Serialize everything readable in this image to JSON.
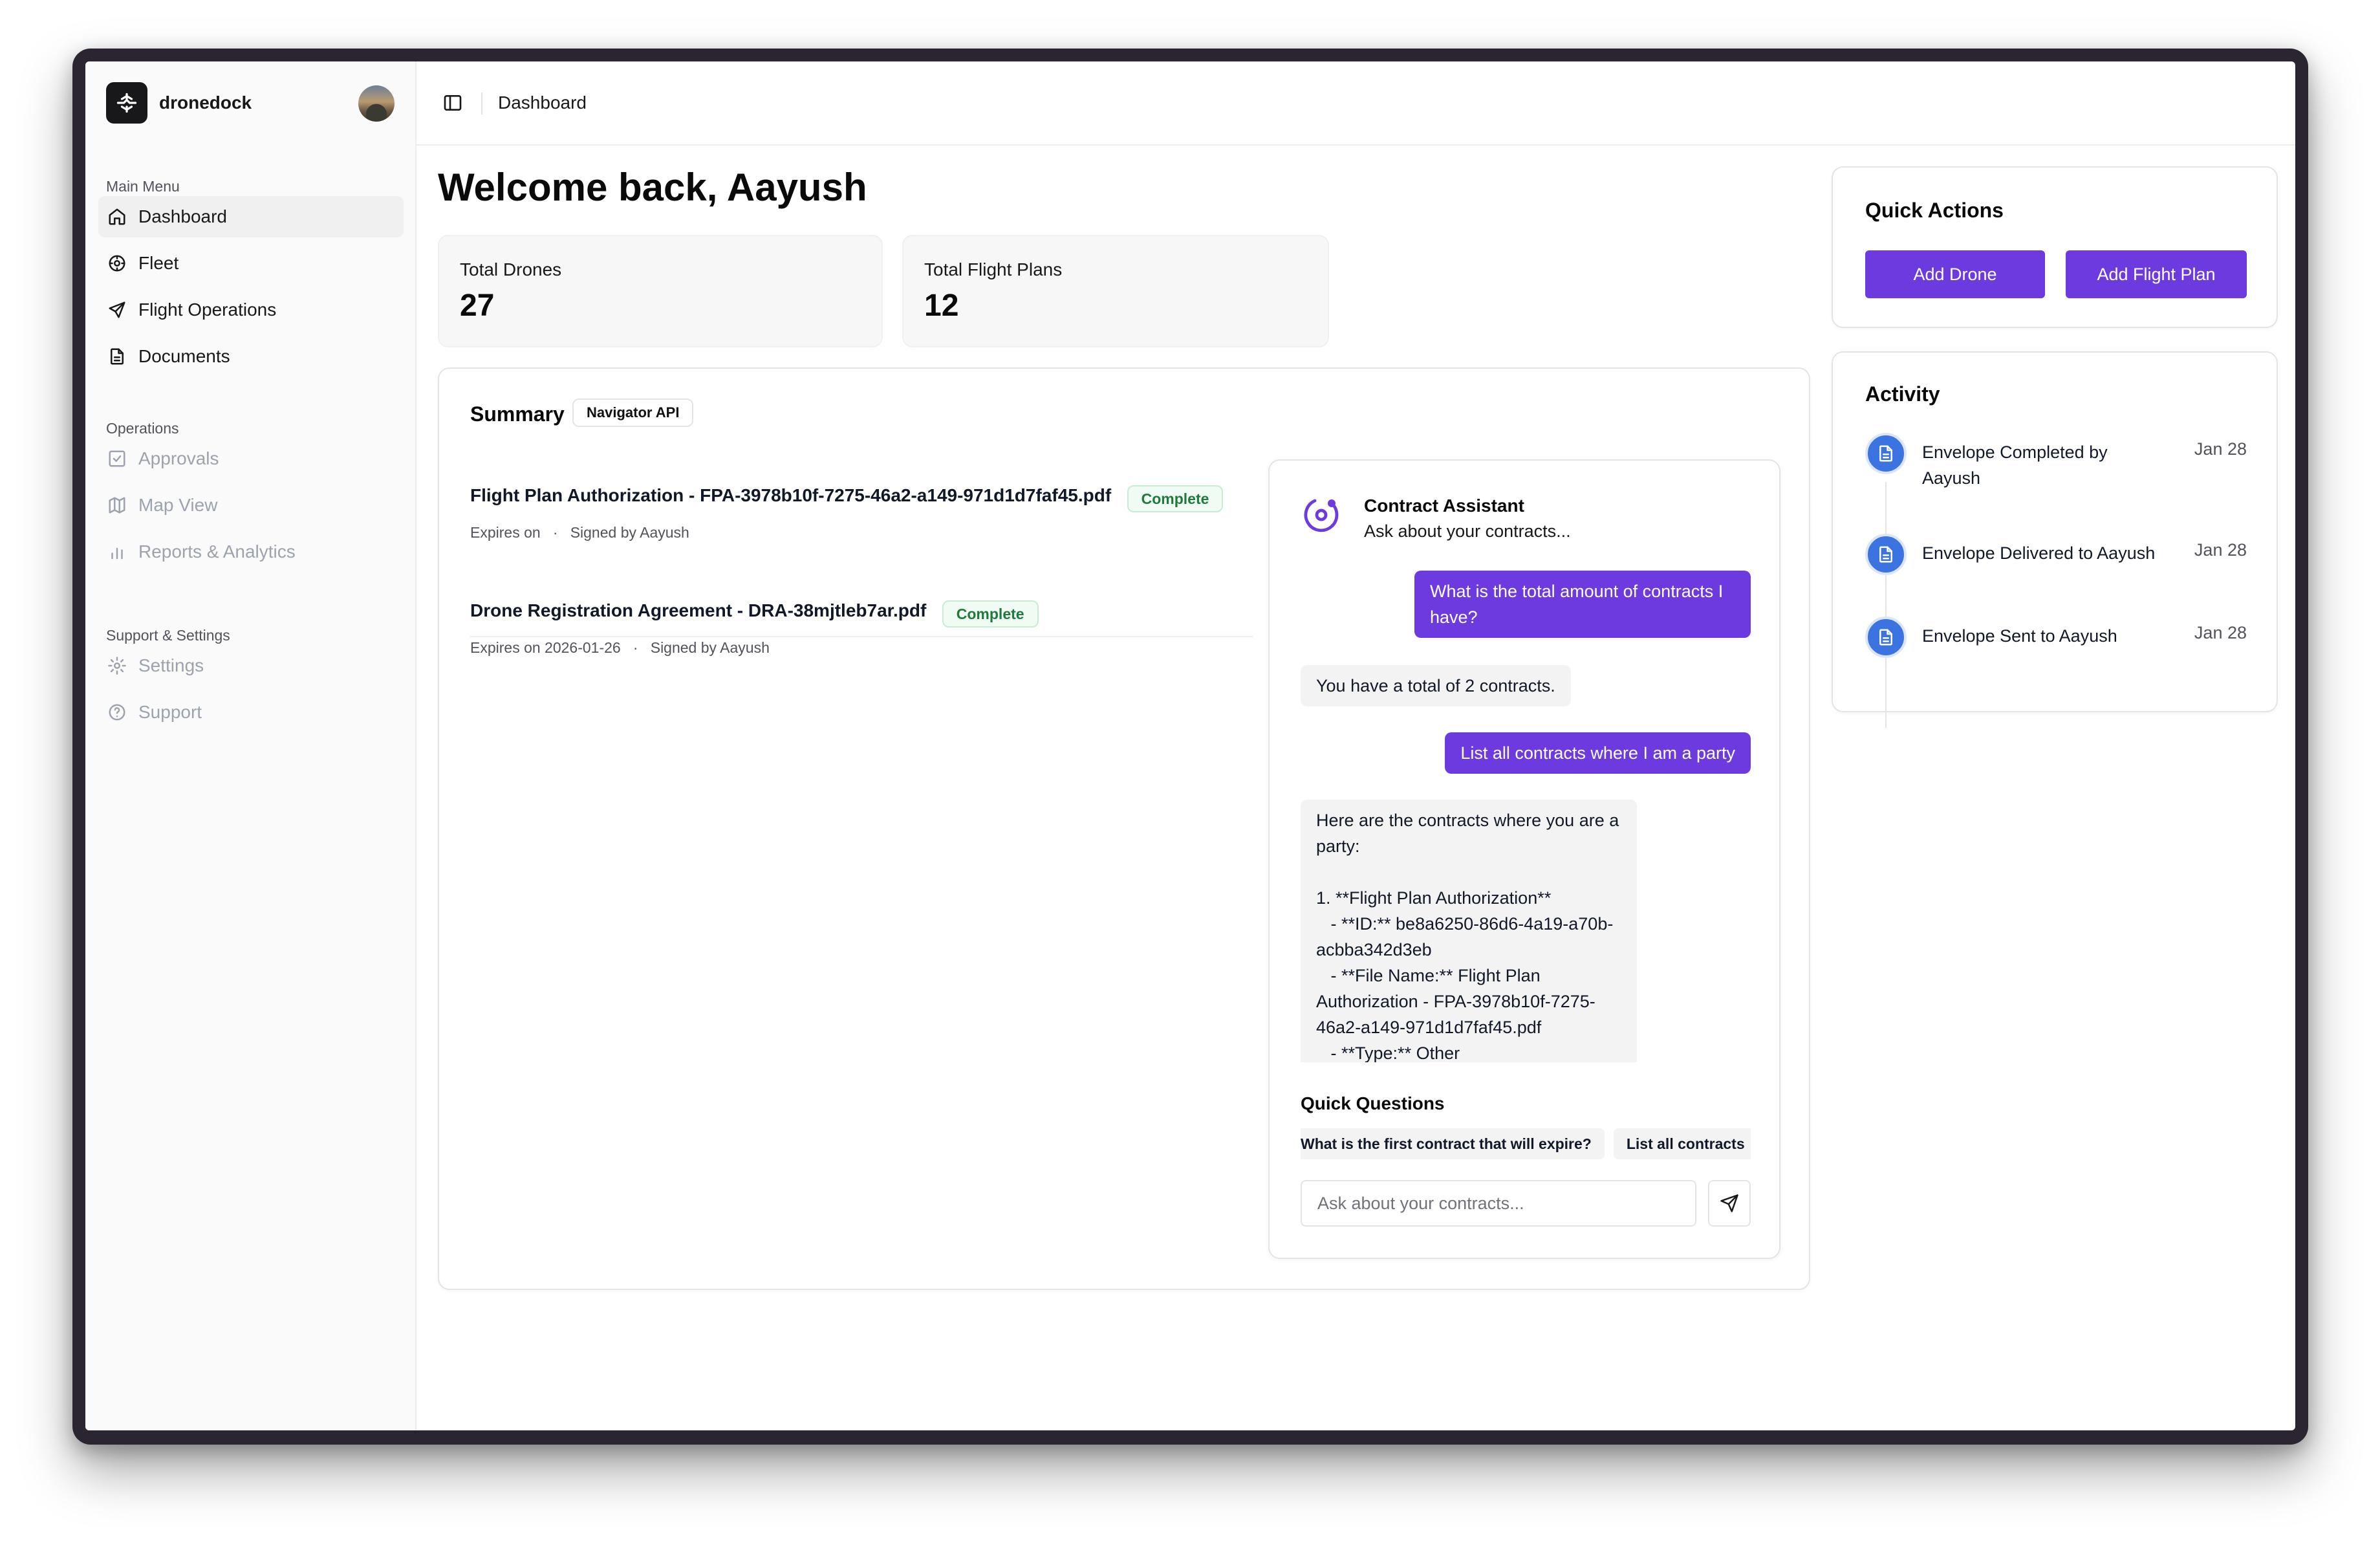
{
  "brand": {
    "name": "dronedock"
  },
  "sidebar": {
    "sections": [
      {
        "label": "Main Menu"
      },
      {
        "label": "Operations"
      },
      {
        "label": "Support & Settings"
      }
    ],
    "main_items": [
      {
        "label": "Dashboard",
        "icon": "home-icon",
        "active": true
      },
      {
        "label": "Fleet",
        "icon": "fleet-icon"
      },
      {
        "label": "Flight Operations",
        "icon": "plane-icon"
      },
      {
        "label": "Documents",
        "icon": "document-icon"
      }
    ],
    "ops_items": [
      {
        "label": "Approvals",
        "icon": "check-square-icon"
      },
      {
        "label": "Map View",
        "icon": "map-icon"
      },
      {
        "label": "Reports & Analytics",
        "icon": "bar-chart-icon"
      }
    ],
    "support_items": [
      {
        "label": "Settings",
        "icon": "gear-icon"
      },
      {
        "label": "Support",
        "icon": "help-circle-icon"
      }
    ]
  },
  "header": {
    "title": "Dashboard"
  },
  "main": {
    "welcome": "Welcome back, Aayush",
    "stats": [
      {
        "label": "Total Drones",
        "value": "27"
      },
      {
        "label": "Total Flight Plans",
        "value": "12"
      }
    ]
  },
  "summary": {
    "title": "Summary",
    "badge": "Navigator API",
    "documents": [
      {
        "title": "Flight Plan Authorization - FPA-3978b10f-7275-46a2-a149-971d1d7faf45.pdf",
        "status": "Complete",
        "expires": "Expires on",
        "signed": "Signed by Aayush"
      },
      {
        "title": "Drone Registration Agreement - DRA-38mjtleb7ar.pdf",
        "status": "Complete",
        "expires": "Expires on 2026-01-26",
        "signed": "Signed by Aayush"
      }
    ],
    "meta_separator": "·"
  },
  "chat": {
    "title": "Contract Assistant",
    "subtitle": "Ask about your contracts...",
    "messages": [
      {
        "role": "user",
        "text": "What is the total amount of contracts I have?"
      },
      {
        "role": "bot",
        "text": "You have a total of 2 contracts."
      },
      {
        "role": "user",
        "text": "List all contracts where I am a party"
      },
      {
        "role": "bot",
        "text": "Here are the contracts where you are a party:\n\n1. **Flight Plan Authorization**\n   - **ID:** be8a6250-86d6-4a19-a70b-acbba342d3eb\n   - **File Name:** Flight Plan Authorization - FPA-3978b10f-7275-46a2-a149-971d1d7faf45.pdf\n   - **Type:** Other"
      }
    ],
    "quick_questions_title": "Quick Questions",
    "quick_questions": [
      "What is the first contract that will expire?",
      "List all contracts"
    ],
    "input_placeholder": "Ask about your contracts..."
  },
  "quick_actions": {
    "title": "Quick Actions",
    "add_drone": "Add Drone",
    "add_flight_plan": "Add Flight Plan"
  },
  "activity": {
    "title": "Activity",
    "items": [
      {
        "text": "Envelope Completed by Aayush",
        "date": "Jan 28"
      },
      {
        "text": "Envelope Delivered to Aayush",
        "date": "Jan 28"
      },
      {
        "text": "Envelope Sent to Aayush",
        "date": "Jan 28"
      }
    ]
  },
  "colors": {
    "accent": "#6d3ae0",
    "activity_icon": "#3b74e0",
    "status_green": "#1f7a3b"
  }
}
